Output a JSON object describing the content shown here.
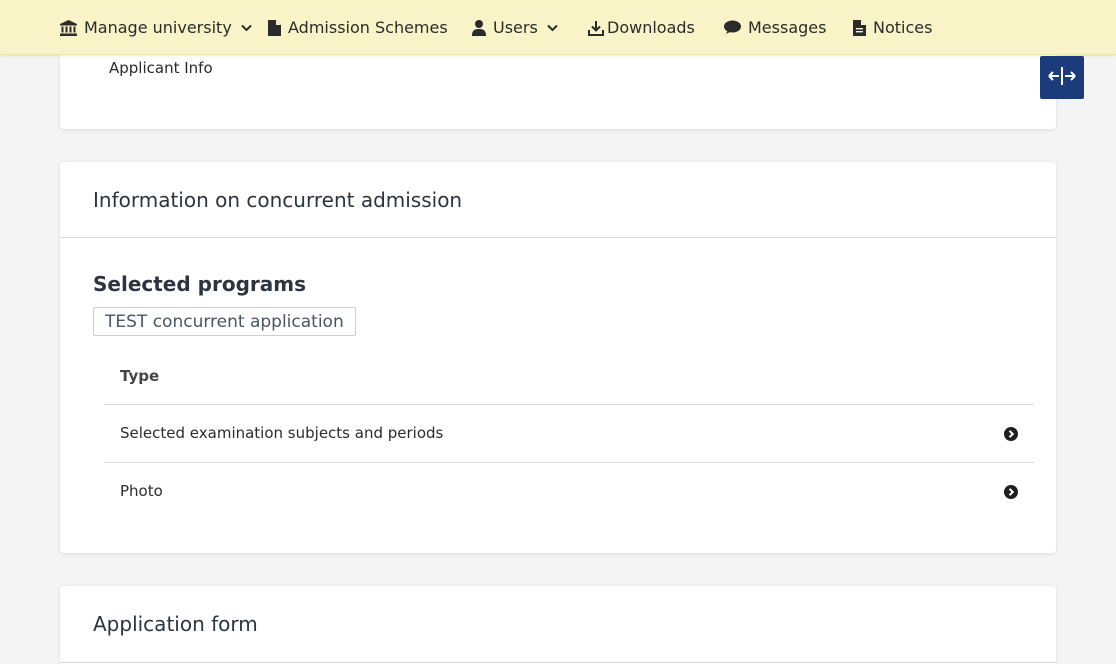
{
  "nav": {
    "manage_university": "Manage university",
    "admission_schemes": "Admission Schemes",
    "users": "Users",
    "downloads": "Downloads",
    "messages": "Messages",
    "notices": "Notices"
  },
  "top_card": {
    "applicant_info": "Applicant Info"
  },
  "concurrent_card": {
    "title": "Information on concurrent admission",
    "selected_programs_heading": "Selected programs",
    "program_chip": "TEST concurrent application",
    "table_header_type": "Type",
    "rows": [
      {
        "label": "Selected examination subjects and periods"
      },
      {
        "label": "Photo"
      }
    ]
  },
  "form_card": {
    "title": "Application form"
  },
  "colors": {
    "navbar_bg": "#f8f4c8",
    "toggle_button_bg": "#1b3b7a",
    "page_bg": "#f4f4f4",
    "card_bg": "#ffffff"
  },
  "icons": {
    "manage_university": "university-icon",
    "admission_schemes": "document-icon",
    "users": "user-icon",
    "downloads": "download-icon",
    "messages": "chat-bubble-icon",
    "notices": "document-icon",
    "toggle": "expand-horizontal-icon",
    "row_arrow": "chevron-circle-right-icon"
  }
}
